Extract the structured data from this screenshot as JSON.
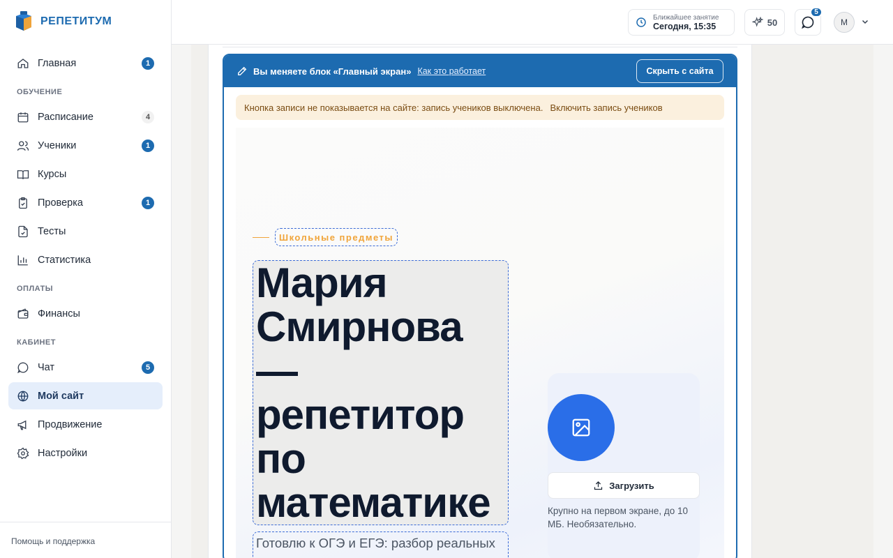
{
  "brand": {
    "name": "РЕПЕТИТУМ"
  },
  "sidebar": {
    "items": [
      {
        "label": "Главная",
        "icon": "home-icon",
        "badge": "1"
      },
      {
        "section": "ОБУЧЕНИЕ"
      },
      {
        "label": "Расписание",
        "icon": "calendar-icon",
        "badge": "4"
      },
      {
        "label": "Ученики",
        "icon": "users-icon",
        "badge": "1"
      },
      {
        "label": "Курсы",
        "icon": "book-icon"
      },
      {
        "label": "Проверка",
        "icon": "clipboard-check-icon",
        "badge": "1"
      },
      {
        "label": "Тесты",
        "icon": "test-file-icon"
      },
      {
        "label": "Статистика",
        "icon": "bar-chart-icon"
      },
      {
        "section": "ОПЛАТЫ"
      },
      {
        "label": "Финансы",
        "icon": "wallet-icon"
      },
      {
        "section": "КАБИНЕТ"
      },
      {
        "label": "Чат",
        "icon": "chat-icon",
        "badge": "5"
      },
      {
        "label": "Мой сайт",
        "icon": "globe-icon",
        "active": true
      },
      {
        "label": "Продвижение",
        "icon": "megaphone-icon"
      },
      {
        "label": "Настройки",
        "icon": "gear-icon"
      }
    ],
    "help": "Помощь и поддержка"
  },
  "topbar": {
    "next_lesson_label": "Ближайшее занятие",
    "next_lesson_value": "Сегодня, 15:35",
    "points": "50",
    "chat_count": "5",
    "avatar_initial": "М"
  },
  "editor": {
    "title": "Вы меняете блок «Главный экран»",
    "how_link": "Как это работает",
    "hide_button": "Скрыть с сайта",
    "notice_text": "Кнопка записи не показывается на сайте: запись учеников выключена.",
    "notice_link": "Включить запись учеников"
  },
  "hero": {
    "tag": "Школьные предметы",
    "title_lines": [
      "Мария",
      "Смирнова",
      "—",
      "репетитор",
      "по",
      "математике"
    ],
    "subtitle": "Готовлю к ОГЭ и ЕГЭ: разбор реальных",
    "upload_label": "Загрузить",
    "photo_hint": "Крупно на первом экране, до 10 МБ. Необязательно."
  },
  "colors": {
    "accent": "#1d6bb0",
    "tag": "#f0a43a",
    "notice_bg": "#fbf0de",
    "photo_circle": "#2a6ee8"
  }
}
